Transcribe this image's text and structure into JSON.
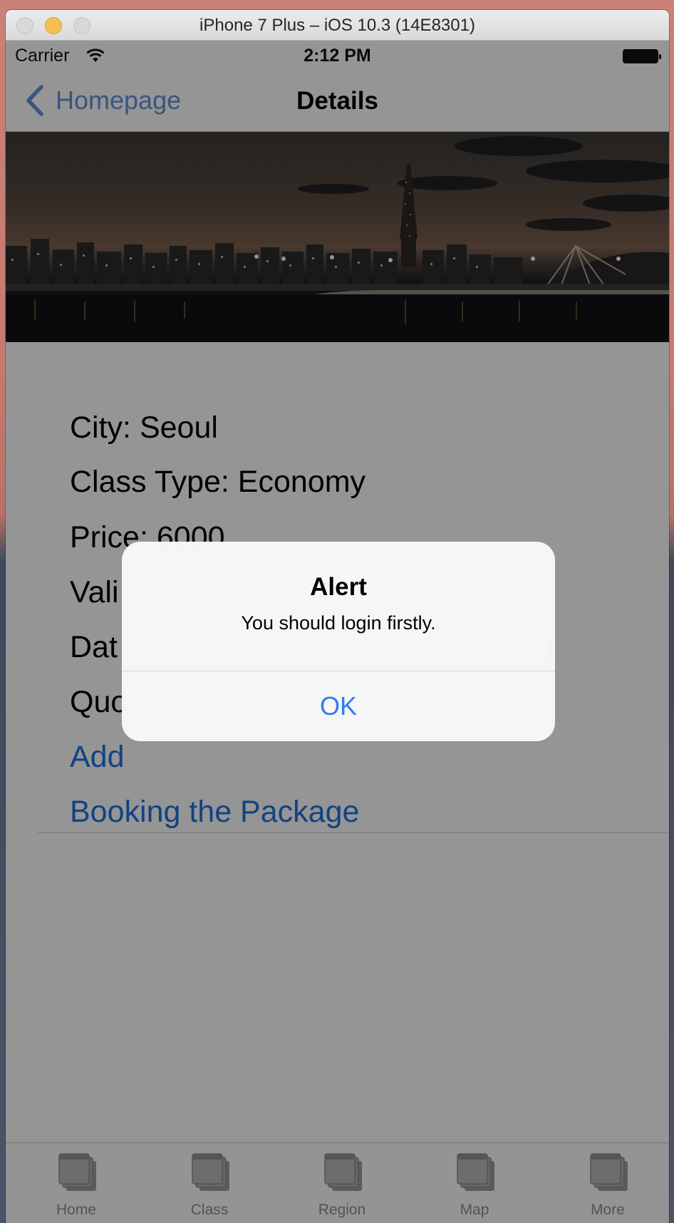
{
  "simulator": {
    "window_title": "iPhone 7 Plus – iOS 10.3 (14E8301)"
  },
  "status_bar": {
    "carrier": "Carrier",
    "time": "2:12 PM"
  },
  "nav": {
    "back_label": "Homepage",
    "title": "Details"
  },
  "banner": {
    "icon": "seoul-skyline-photo"
  },
  "details": {
    "city": "City: Seoul",
    "class_type": "Class Type: Economy",
    "price": "Price: 6000",
    "validity": "Vali",
    "dates": "Dat",
    "dates_tail": ")",
    "quota": "Quo"
  },
  "actions": {
    "add": "Add",
    "book": "Booking the Package"
  },
  "tabs": [
    {
      "label": "Home",
      "icon": "stacked-windows-icon"
    },
    {
      "label": "Class",
      "icon": "stacked-windows-icon"
    },
    {
      "label": "Region",
      "icon": "stacked-windows-icon"
    },
    {
      "label": "Map",
      "icon": "stacked-windows-icon"
    },
    {
      "label": "More",
      "icon": "stacked-windows-icon"
    }
  ],
  "alert": {
    "title": "Alert",
    "message": "You should login firstly.",
    "ok_label": "OK"
  },
  "colors": {
    "ios_blue": "#2f7cf6",
    "dim_overlay": "rgba(0,0,0,0.4)",
    "tab_inactive": "#8a8a8a"
  }
}
